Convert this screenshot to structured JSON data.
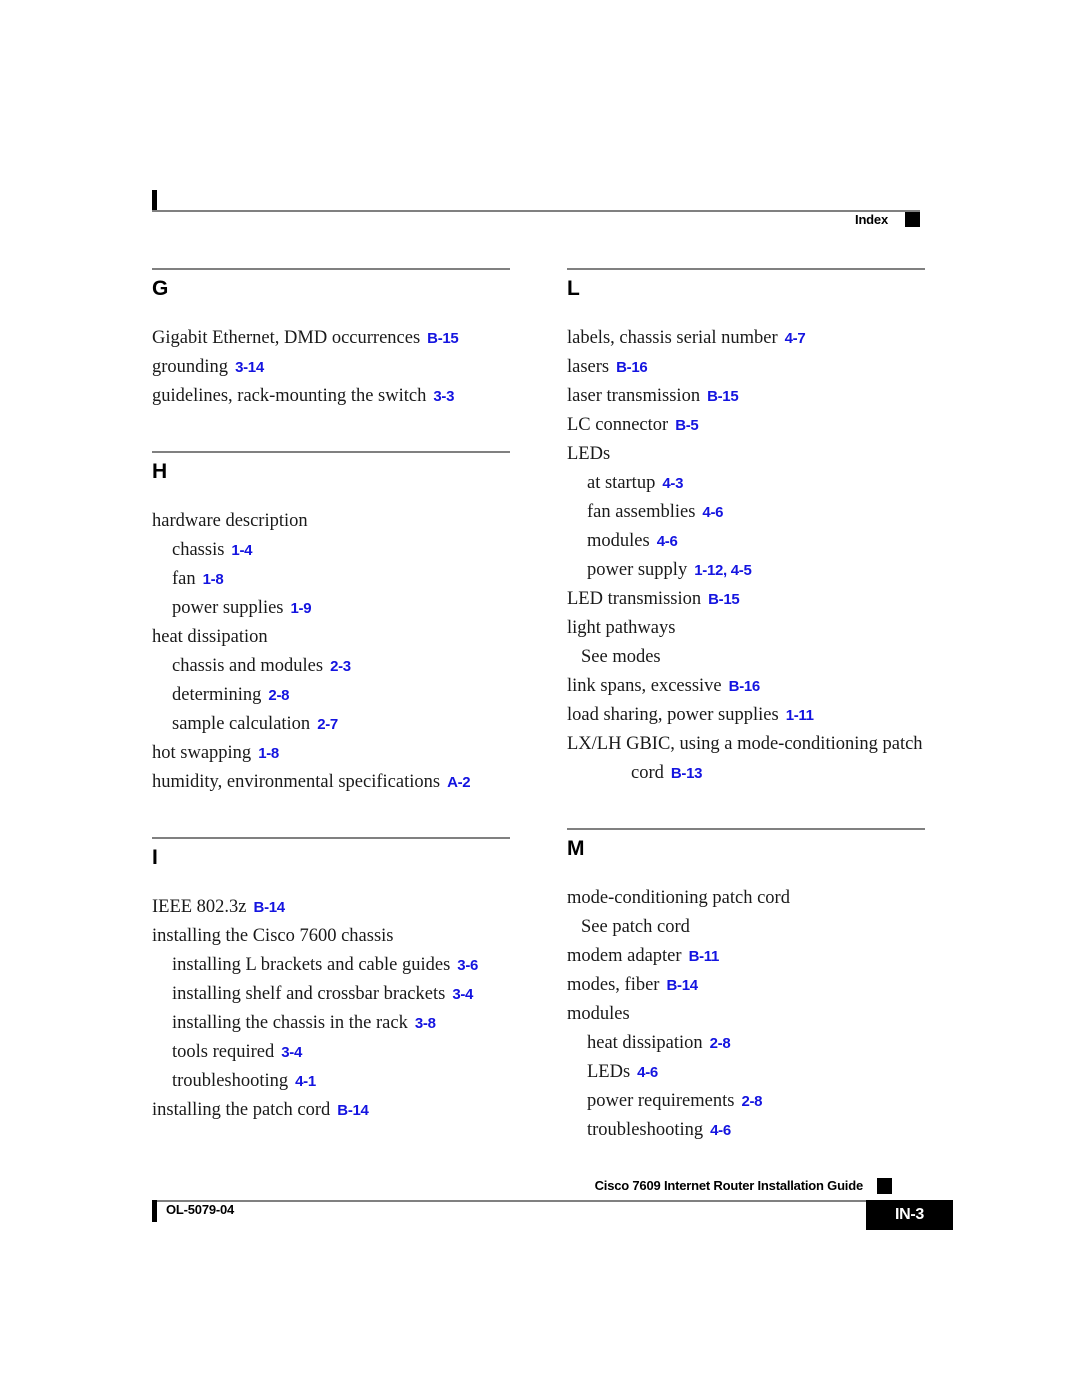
{
  "header": {
    "label": "Index"
  },
  "footer": {
    "doc_id": "OL-5079-04",
    "guide_title": "Cisco 7609 Internet Router Installation Guide",
    "page_number": "IN-3"
  },
  "colors": {
    "page_ref": "#1414e0",
    "rule": "#808080",
    "marker": "#000000"
  },
  "columns": {
    "left": [
      {
        "letter": "G",
        "entries": [
          {
            "level": 1,
            "text": "Gigabit Ethernet, DMD occurrences",
            "page": "B-15"
          },
          {
            "level": 1,
            "text": "grounding",
            "page": "3-14"
          },
          {
            "level": 1,
            "text": "guidelines, rack-mounting the switch",
            "page": "3-3"
          }
        ]
      },
      {
        "letter": "H",
        "entries": [
          {
            "level": 1,
            "text": "hardware description",
            "page": ""
          },
          {
            "level": 2,
            "text": "chassis",
            "page": "1-4"
          },
          {
            "level": 2,
            "text": "fan",
            "page": "1-8"
          },
          {
            "level": 2,
            "text": "power supplies",
            "page": "1-9"
          },
          {
            "level": 1,
            "text": "heat dissipation",
            "page": ""
          },
          {
            "level": 2,
            "text": "chassis and modules",
            "page": "2-3"
          },
          {
            "level": 2,
            "text": "determining",
            "page": "2-8"
          },
          {
            "level": 2,
            "text": "sample calculation",
            "page": "2-7"
          },
          {
            "level": 1,
            "text": "hot swapping",
            "page": "1-8"
          },
          {
            "level": 1,
            "text": "humidity, environmental specifications",
            "page": "A-2"
          }
        ]
      },
      {
        "letter": "I",
        "entries": [
          {
            "level": 1,
            "text": "IEEE 802.3z",
            "page": "B-14"
          },
          {
            "level": 1,
            "text": "installing the Cisco 7600 chassis",
            "page": ""
          },
          {
            "level": 2,
            "text": "installing L brackets and cable guides",
            "page": "3-6"
          },
          {
            "level": 2,
            "text": "installing shelf and crossbar brackets",
            "page": "3-4"
          },
          {
            "level": 2,
            "text": "installing the chassis in the rack",
            "page": "3-8"
          },
          {
            "level": 2,
            "text": "tools required",
            "page": "3-4"
          },
          {
            "level": 2,
            "text": "troubleshooting",
            "page": "4-1"
          },
          {
            "level": 1,
            "text": "installing the patch cord",
            "page": "B-14"
          }
        ]
      }
    ],
    "right": [
      {
        "letter": "L",
        "entries": [
          {
            "level": 1,
            "text": "labels, chassis serial number",
            "page": "4-7"
          },
          {
            "level": 1,
            "text": "lasers",
            "page": "B-16"
          },
          {
            "level": 1,
            "text": "laser transmission",
            "page": "B-15"
          },
          {
            "level": 1,
            "text": "LC connector",
            "page": "B-5"
          },
          {
            "level": 1,
            "text": "LEDs",
            "page": ""
          },
          {
            "level": 2,
            "text": "at startup",
            "page": "4-3"
          },
          {
            "level": 2,
            "text": "fan assemblies",
            "page": "4-6"
          },
          {
            "level": 2,
            "text": "modules",
            "page": "4-6"
          },
          {
            "level": 2,
            "text": "power supply",
            "page": "1-12, 4-5"
          },
          {
            "level": 1,
            "text": "LED transmission",
            "page": "B-15"
          },
          {
            "level": 1,
            "text": "light pathways",
            "page": ""
          },
          {
            "level": 0,
            "text": "See modes",
            "page": ""
          },
          {
            "level": 1,
            "text": "link spans, excessive",
            "page": "B-16"
          },
          {
            "level": 1,
            "text": "load sharing, power supplies",
            "page": "1-11"
          },
          {
            "level": 1,
            "wrapped": true,
            "text": "LX/LH GBIC, using a mode-conditioning patch",
            "cont_text": "cord",
            "page": "B-13"
          }
        ]
      },
      {
        "letter": "M",
        "entries": [
          {
            "level": 1,
            "text": "mode-conditioning patch cord",
            "page": ""
          },
          {
            "level": 0,
            "text": "See patch cord",
            "page": ""
          },
          {
            "level": 1,
            "text": "modem adapter",
            "page": "B-11"
          },
          {
            "level": 1,
            "text": "modes, fiber",
            "page": "B-14"
          },
          {
            "level": 1,
            "text": "modules",
            "page": ""
          },
          {
            "level": 2,
            "text": "heat dissipation",
            "page": "2-8"
          },
          {
            "level": 2,
            "text": "LEDs",
            "page": "4-6"
          },
          {
            "level": 2,
            "text": "power requirements",
            "page": "2-8"
          },
          {
            "level": 2,
            "text": "troubleshooting",
            "page": "4-6"
          }
        ]
      }
    ]
  }
}
